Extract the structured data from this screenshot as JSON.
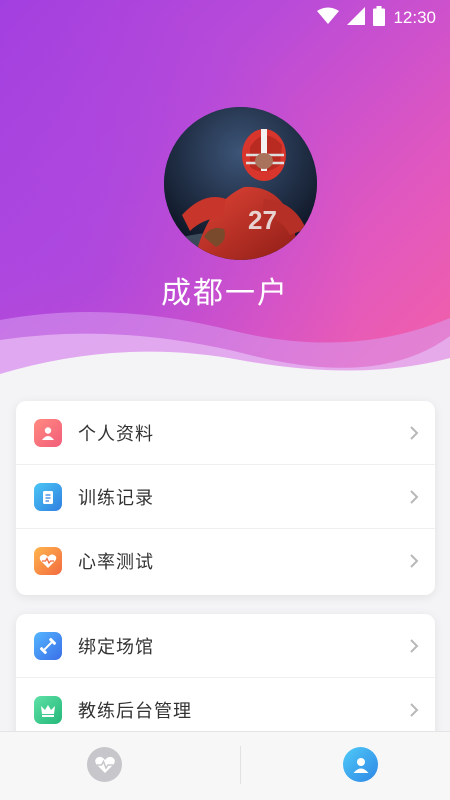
{
  "status_bar": {
    "time": "12:30"
  },
  "profile": {
    "username": "成都一户",
    "avatar": "football-player-avatar"
  },
  "menu_group_1": [
    {
      "label": "个人资料",
      "icon": "person-icon",
      "color": "#f25d7a"
    },
    {
      "label": "训练记录",
      "icon": "clipboard-icon",
      "color": "#2f7fe0"
    },
    {
      "label": "心率测试",
      "icon": "heart-rate-icon",
      "color": "#f26a3f"
    }
  ],
  "menu_group_2": [
    {
      "label": "绑定场馆",
      "icon": "dumbbell-icon",
      "color": "#3a6ee8"
    },
    {
      "label": "教练后台管理",
      "icon": "crown-icon",
      "color": "#23b879"
    }
  ],
  "tab_bar": {
    "tabs": [
      {
        "icon": "heart-rate-icon",
        "active": false
      },
      {
        "icon": "user-icon",
        "active": true
      }
    ]
  },
  "colors": {
    "header_start": "#a23fe0",
    "header_end": "#f562a6",
    "active_tab": "#2e86e6"
  }
}
